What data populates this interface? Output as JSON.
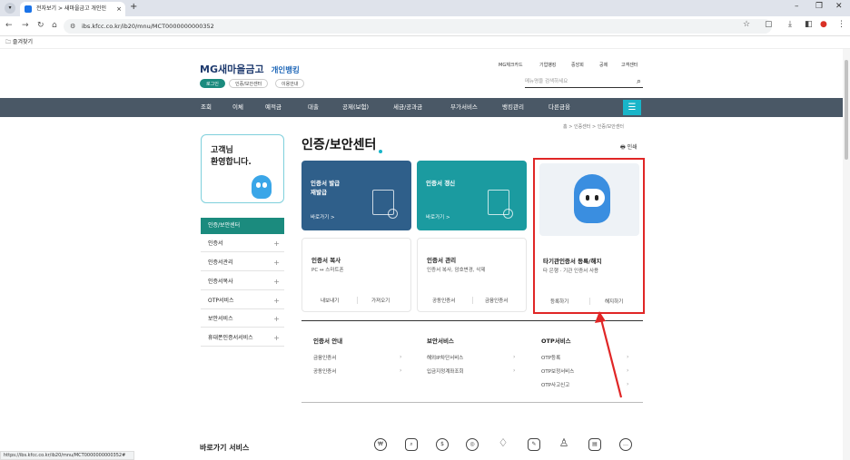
{
  "browser": {
    "tab_title": "전자보기 > 새마을금고 개인인",
    "tab_close": "×",
    "new_tab": "+",
    "url": "ibs.kfcc.co.kr/ib20/mnu/MCT0000000000352",
    "bookmarks_label": "즐겨찾기",
    "status_url": "https://ibs.kfcc.co.kr/ib20/mnu/MCT0000000000352#"
  },
  "header": {
    "logo": "MG새마을금고",
    "logo_sub": "개인뱅킹",
    "login": "로그인",
    "cert_center": "인증/보안센터",
    "usage": "이용안내",
    "util_links": [
      "MG체크카드",
      "기업뱅킹",
      "중앙회",
      "공제",
      "고객센터"
    ],
    "search_placeholder": "메뉴명을 검색하세요"
  },
  "gnb": {
    "items": [
      "조회",
      "이체",
      "예적금",
      "대출",
      "공제(보험)",
      "세금/공과금",
      "부가서비스",
      "뱅킹관리",
      "다른금융"
    ]
  },
  "breadcrumb": "홈 > 인증센터 > 인증/보안센터",
  "sidebar": {
    "welcome_line1": "고객님",
    "welcome_line2": "환영합니다.",
    "head": "인증/보안센터",
    "items": [
      {
        "label": "인증서"
      },
      {
        "label": "인증서관리"
      },
      {
        "label": "인증서복사"
      },
      {
        "label": "OTP서비스"
      },
      {
        "label": "보안서비스"
      },
      {
        "label": "휴대폰인증서서비스"
      }
    ]
  },
  "main": {
    "title": "인증/보안센터",
    "print": "인쇄",
    "card_issue": {
      "title1": "인증서 발급",
      "title2": "재발급",
      "go": "바로가기 >"
    },
    "card_renew": {
      "title": "인증서 갱신",
      "go": "바로가기 >"
    },
    "card_copy": {
      "title": "인증서 복사",
      "desc": "PC ↔ 스마트폰",
      "btn1": "내보내기",
      "btn2": "가져오기"
    },
    "card_manage": {
      "title": "인증서 관리",
      "desc": "인증서 복사, 암호변경, 삭제",
      "btn1": "공동인증서",
      "btn2": "금융인증서"
    },
    "card_other": {
      "title": "타기관인증서 등록/해지",
      "desc": "타 은행 · 기관 인증서 사용",
      "btn1": "등록하기",
      "btn2": "해지하기"
    },
    "sections": [
      {
        "title": "인증서 안내",
        "items": [
          "금융인증서",
          "공동인증서"
        ]
      },
      {
        "title": "보안서비스",
        "items": [
          "해외IP차단서비스",
          "입금지정계좌조회"
        ]
      },
      {
        "title": "OTP서비스",
        "items": [
          "OTP등록",
          "OTP보정서비스",
          "OTP사고신고"
        ]
      }
    ]
  },
  "quick": {
    "title": "바로가기 서비스"
  },
  "colors": {
    "gnb": "#4a5866",
    "accent": "#1b8b7e",
    "highlight": "#e02626"
  }
}
